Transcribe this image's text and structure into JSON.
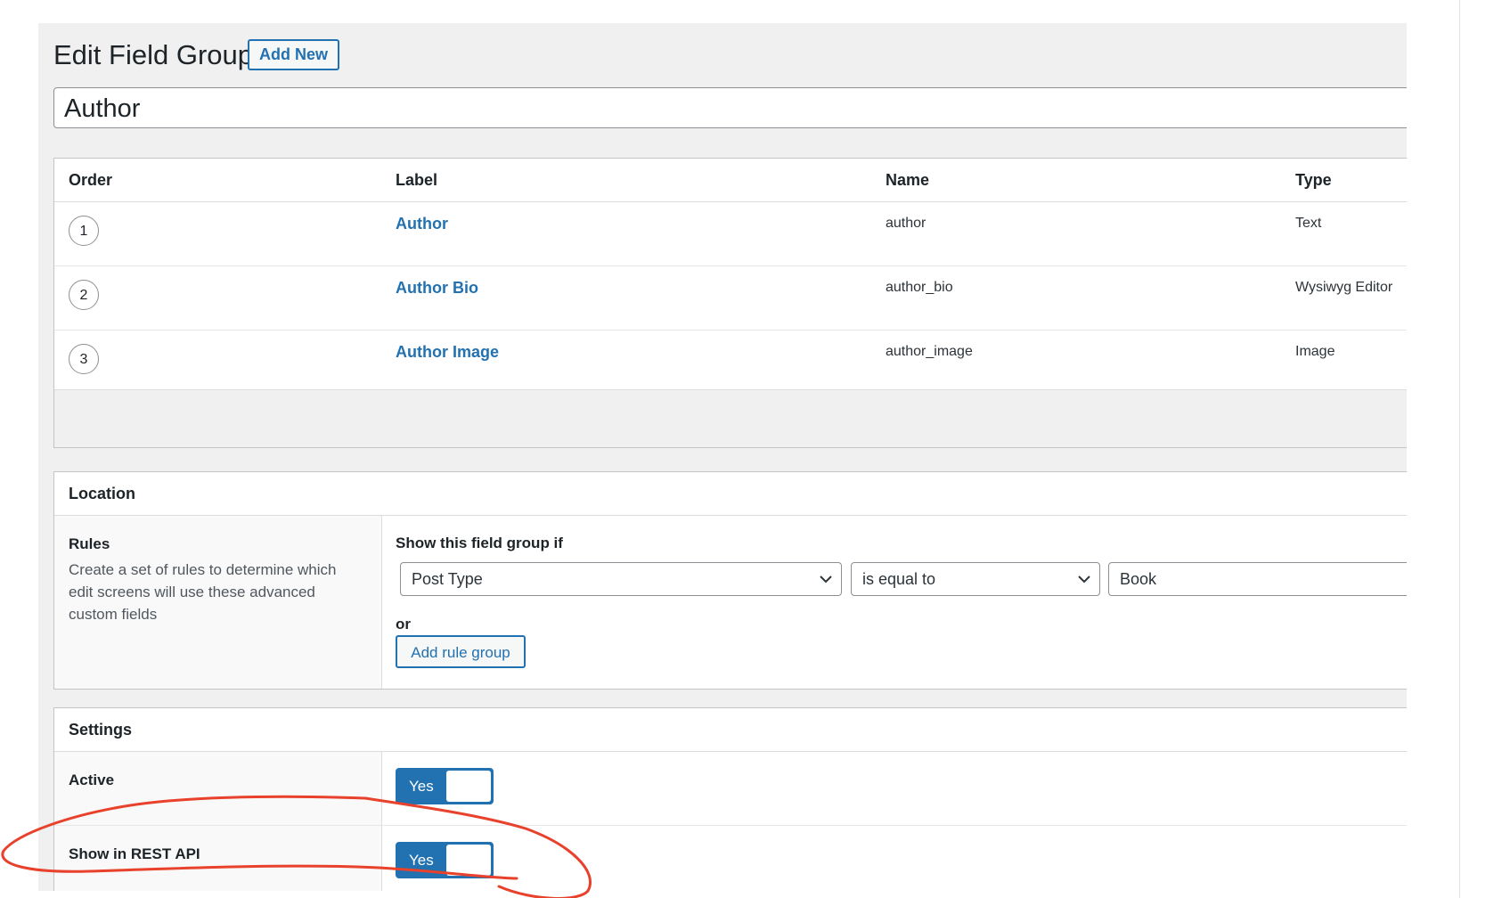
{
  "header": {
    "title": "Edit Field Group",
    "add_new_label": "Add New"
  },
  "title_field": {
    "value": "Author"
  },
  "fields_table": {
    "columns": [
      "Order",
      "Label",
      "Name",
      "Type"
    ],
    "rows": [
      {
        "order": "1",
        "label": "Author",
        "name": "author",
        "type": "Text"
      },
      {
        "order": "2",
        "label": "Author Bio",
        "name": "author_bio",
        "type": "Wysiwyg Editor"
      },
      {
        "order": "3",
        "label": "Author Image",
        "name": "author_image",
        "type": "Image"
      }
    ]
  },
  "location": {
    "heading": "Location",
    "rules_title": "Rules",
    "rules_description": "Create a set of rules to determine which edit screens will use these advanced custom fields",
    "show_if_label": "Show this field group if",
    "param_select": "Post Type",
    "operator_select": "is equal to",
    "value_select": "Book",
    "or_label": "or",
    "add_rule_group_label": "Add rule group"
  },
  "settings": {
    "heading": "Settings",
    "active_label": "Active",
    "active_toggle": "Yes",
    "rest_label": "Show in REST API",
    "rest_toggle": "Yes"
  },
  "colors": {
    "accent": "#2271b1",
    "annotation": "#e8412c"
  }
}
